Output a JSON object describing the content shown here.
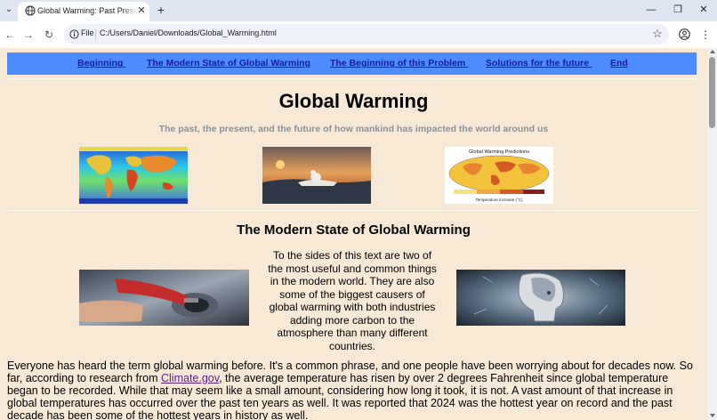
{
  "browser": {
    "tab_title": "Global Warming: Past Present and Future",
    "new_tab_symbol": "+",
    "file_label": "File",
    "url": "C:/Users/Daniel/Downloads/Global_Warming.html",
    "window_controls": {
      "minimize": "—",
      "restore": "❐",
      "close": "✕"
    }
  },
  "page": {
    "nav": [
      "Beginning ",
      "The Modern State of Global Warming",
      "The Beginning of this Problem ",
      "Solutions for the future ",
      "End"
    ],
    "title": "Global Warming",
    "subtitle": "The past, the present, and the future of how mankind has impacted the world around us",
    "prediction_map": {
      "title": "Global Warming Predictions",
      "caption": "Temperature Increase (°C)"
    },
    "section_title": "The Modern State of Global Warming",
    "center_text": "To the sides of this text are two of the most useful and common things in the modern world. They are also some of the biggest causers of global warming with both industries adding more carbon to the atmosphere than many different countries.",
    "body": {
      "before_link": "Everyone has heard the term global warming before. It's a common phrase, and one people have been worrying about for decades now. So far, according to research from ",
      "link": "Climate.gov",
      "after_link": ", the average temperature has risen by over 2 degrees Fahrenheit since global temperature began to be recorded. While that may seem like a small amount, considering how long it took, it is not. A vast amount of that increase in global temperatures has occurred over the past ten years as well. It was reported that 2024 was the hottest year on record and the past decade has been some of the hottest years in history as well."
    }
  },
  "icons": {
    "tab_menu": "chevron-down-icon",
    "favicon": "globe-icon",
    "tab_close": "close-icon",
    "back": "back-arrow-icon",
    "forward": "forward-arrow-icon",
    "reload": "reload-icon",
    "info": "info-icon",
    "bookmark": "star-icon",
    "profile": "profile-icon",
    "menu": "kebab-menu-icon"
  },
  "colors": {
    "page_background": "#f7e9d6",
    "nav_background": "#4d8cff",
    "nav_link": "#1b1a9e",
    "subtitle": "#8b909b",
    "visited_link": "#5a1d87"
  }
}
